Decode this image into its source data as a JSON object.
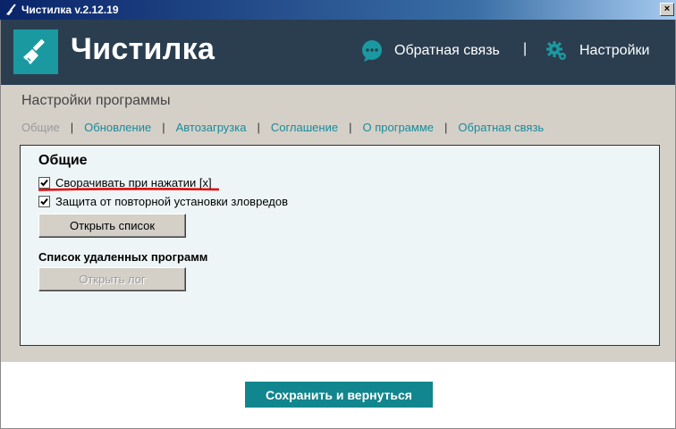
{
  "window": {
    "title": "Чистилка v.2.12.19",
    "close_glyph": "×"
  },
  "header": {
    "brand": "Чистилка",
    "brand_icon": "broom-icon",
    "feedback_label": "Обратная связь",
    "feedback_icon": "chat-bubble-icon",
    "separator": "|",
    "settings_label": "Настройки",
    "settings_icon": "gear-icon",
    "colors": {
      "header_bg": "#2b3e50",
      "logo_bg": "#1a9aa0",
      "accent": "#12868e"
    }
  },
  "settings_page": {
    "title": "Настройки программы",
    "tabs": [
      {
        "label": "Общие",
        "active": true
      },
      {
        "label": "Обновление",
        "active": false
      },
      {
        "label": "Автозагрузка",
        "active": false
      },
      {
        "label": "Соглашение",
        "active": false
      },
      {
        "label": "О программе",
        "active": false
      },
      {
        "label": "Обратная связь",
        "active": false
      }
    ],
    "tab_separator": "|",
    "general": {
      "heading": "Общие",
      "checkboxes": [
        {
          "label": "Сворачивать при нажатии [x]",
          "checked": true
        },
        {
          "label": "Защита от повторной установки зловредов",
          "checked": true
        }
      ],
      "open_list_button": "Открыть список",
      "removed_programs_heading": "Список удаленных программ",
      "open_log_button": "Открыть лог",
      "open_log_enabled": false
    }
  },
  "footer": {
    "save_button": "Сохранить и вернуться"
  }
}
